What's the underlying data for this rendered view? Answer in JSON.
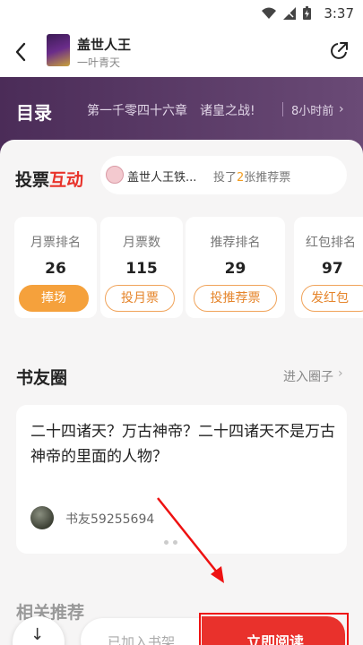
{
  "status_bar": {
    "time": "3:37",
    "icons": [
      "wifi-icon",
      "signal-icon",
      "battery-icon"
    ]
  },
  "header": {
    "book_title": "盖世人王",
    "author": "一叶青天"
  },
  "catalog": {
    "label": "目录",
    "latest_chapter": "第一千零四十六章　诸皇之战!",
    "updated": "8小时前"
  },
  "vote": {
    "title_a": "投票",
    "title_b": "互动",
    "fan_name": "盖世人王铁...",
    "fan_text_prefix": "投了",
    "fan_count": "2",
    "fan_text_suffix": "张推荐票"
  },
  "stats": [
    {
      "label": "月票排名",
      "value": "26",
      "button": "捧场"
    },
    {
      "label": "月票数",
      "value": "115",
      "button": "投月票"
    },
    {
      "label": "推荐排名",
      "value": "29",
      "button": "投推荐票"
    },
    {
      "label": "红包排名",
      "value": "97",
      "button": "发红包"
    }
  ],
  "circle": {
    "title": "书友圈",
    "link": "进入圈子",
    "post_text": "二十四诸天？万古神帝？二十四诸天不是万古神帝的里面的人物？",
    "post_user": "书友59255694"
  },
  "recommend": {
    "title": "相关推荐"
  },
  "bottom": {
    "shelf_label": "已加入书架",
    "read_label": "立即阅读"
  },
  "colors": {
    "accent_red": "#e9312c",
    "accent_orange": "#f5a13c",
    "catalog_purple": "#4b2c58"
  }
}
